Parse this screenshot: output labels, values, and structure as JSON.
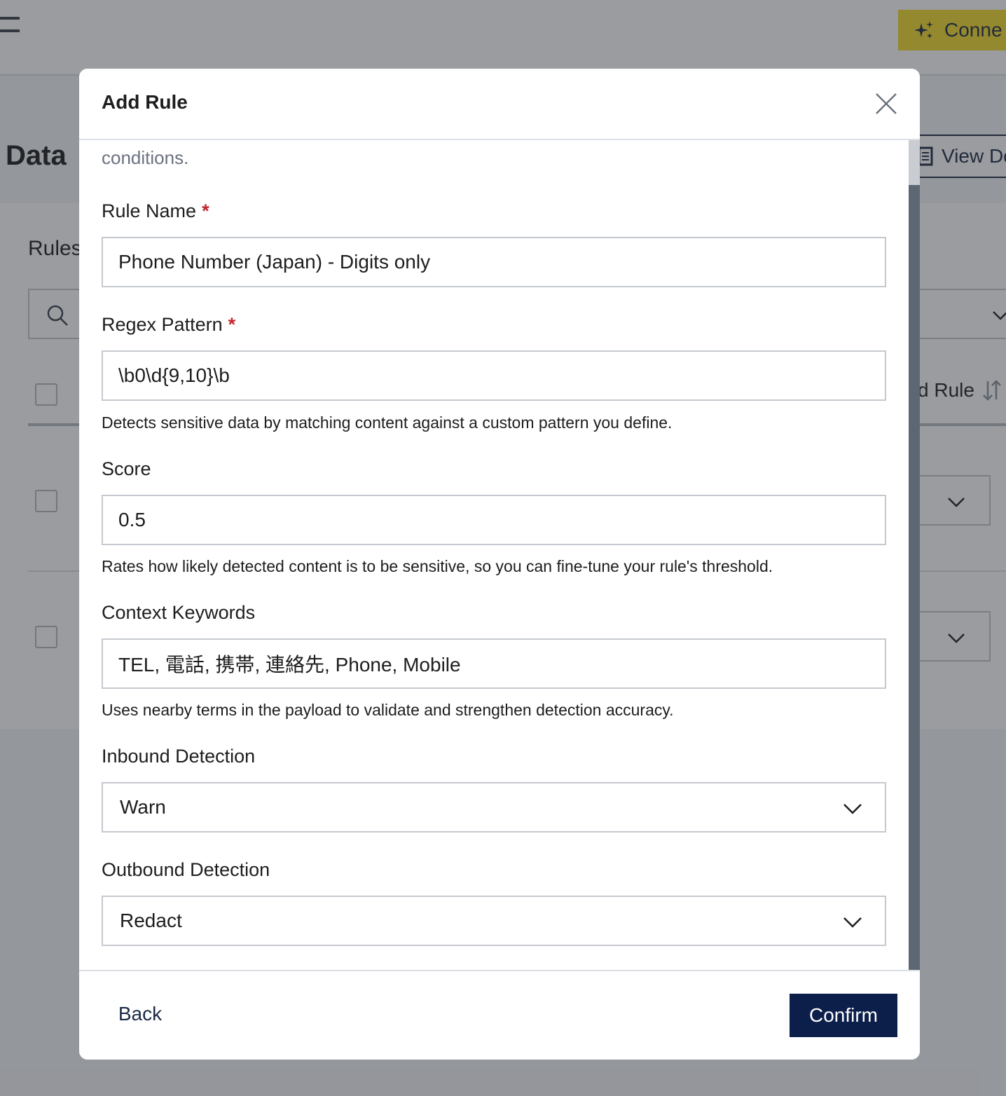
{
  "app": {
    "connect_label": "Conne",
    "page_title": "Data",
    "view_docs_label": "View Do",
    "rules_label": "Rules",
    "column_rule_label": "d Rule"
  },
  "modal": {
    "title": "Add Rule",
    "intro_text": "conditions.",
    "fields": {
      "rule_name": {
        "label": "Rule Name",
        "required_mark": "*",
        "value": "Phone Number (Japan) - Digits only"
      },
      "regex_pattern": {
        "label": "Regex Pattern",
        "required_mark": "*",
        "value": "\\b0\\d{9,10}\\b",
        "helper": "Detects sensitive data by matching content against a custom pattern you define."
      },
      "score": {
        "label": "Score",
        "value": "0.5",
        "helper": "Rates how likely detected content is to be sensitive, so you can fine-tune your rule's threshold."
      },
      "context_keywords": {
        "label": "Context Keywords",
        "value": "TEL, 電話, 携帯, 連絡先, Phone, Mobile",
        "helper": "Uses nearby terms in the payload to validate and strengthen detection accuracy."
      },
      "inbound_detection": {
        "label": "Inbound Detection",
        "value": "Warn"
      },
      "outbound_detection": {
        "label": "Outbound Detection",
        "value": "Redact"
      }
    },
    "footer": {
      "back_label": "Back",
      "confirm_label": "Confirm"
    }
  },
  "colors": {
    "accent": "#f3db2c",
    "primary": "#0c1e4a",
    "required": "#c0262d"
  }
}
